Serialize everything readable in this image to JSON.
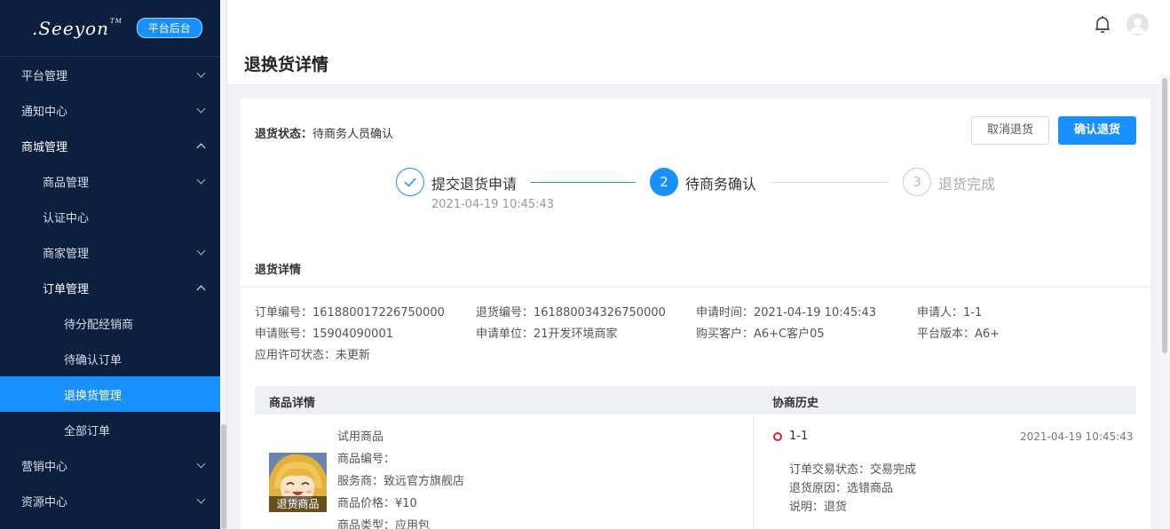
{
  "brand": {
    "logo": ".Seeyon",
    "tm": "TM",
    "badge": "平台后台"
  },
  "sidebar": {
    "items": [
      {
        "label": "平台管理"
      },
      {
        "label": "通知中心"
      },
      {
        "label": "商城管理"
      },
      {
        "label": "商品管理"
      },
      {
        "label": "认证中心"
      },
      {
        "label": "商家管理"
      },
      {
        "label": "订单管理"
      },
      {
        "label": "待分配经销商"
      },
      {
        "label": "待确认订单"
      },
      {
        "label": "退换货管理"
      },
      {
        "label": "全部订单"
      },
      {
        "label": "营销中心"
      },
      {
        "label": "资源中心"
      }
    ]
  },
  "header": {
    "title": "退换货详情"
  },
  "status": {
    "label": "退货状态：",
    "value": "待商务人员确认"
  },
  "buttons": {
    "cancel": "取消退货",
    "confirm": "确认退货"
  },
  "steps": [
    {
      "title": "提交退货申请",
      "time": "2021-04-19 10:45:43",
      "state": "finished"
    },
    {
      "number": "2",
      "title": "待商务确认",
      "state": "active"
    },
    {
      "number": "3",
      "title": "退货完成",
      "state": "waiting"
    }
  ],
  "detail": {
    "section_title": "退货详情",
    "fields": [
      "订单编号：161880017226750000",
      "退货编号：161880034326750000",
      "申请时间：2021-04-19 10:45:43",
      "申请人：1-1",
      "申请账号：15904090001",
      "申请单位：21开发环境商家",
      "购买客户：A6+C客户05",
      "平台版本：A6+",
      "应用许可状态：未更新"
    ]
  },
  "table": {
    "product_header": "商品详情",
    "history_header": "协商历史"
  },
  "product": {
    "thumb_caption": "退货商品",
    "lines": [
      "试用商品",
      "商品编号：",
      "服务商：致远官方旗舰店",
      "商品价格：¥10",
      "商品类型：应用包"
    ]
  },
  "history": {
    "user": "1-1",
    "time": "2021-04-19 10:45:43",
    "lines": [
      "订单交易状态：交易完成",
      "退货原因：选错商品",
      "说明：退货"
    ]
  },
  "colors": {
    "primary": "#1890ff",
    "sidebar_bg": "#0d1f3f",
    "history_dot": "#e02020"
  }
}
